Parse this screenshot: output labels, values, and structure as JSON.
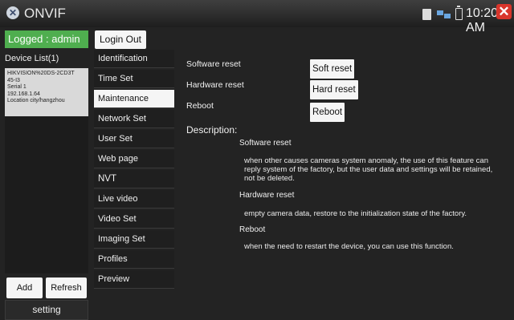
{
  "titlebar": {
    "app_title": "ONVIF",
    "app_icon": "x-circle-icon",
    "time": "10:20 AM",
    "status_icons": [
      "sd-card-icon",
      "network-icon",
      "battery-icon"
    ],
    "close_icon": "close-icon",
    "close_glyph": "✕"
  },
  "left": {
    "logged_label": "Logged : admin",
    "device_list_label": "Device List(1)",
    "device": {
      "line1": "HIKVISION%20DS-2CD3T",
      "line2": "45-I3",
      "line3": "Serial 1",
      "line4": "192.168.1.64",
      "line5": "Location city/hangzhou"
    },
    "add_label": "Add",
    "refresh_label": "Refresh",
    "setting_label": "setting"
  },
  "header": {
    "logout_label": "Login Out"
  },
  "menu": {
    "items": [
      {
        "label": "Identification"
      },
      {
        "label": "Time Set"
      },
      {
        "label": "Maintenance"
      },
      {
        "label": "Network Set"
      },
      {
        "label": "User Set"
      },
      {
        "label": "Web page"
      },
      {
        "label": "NVT"
      },
      {
        "label": "Live video"
      },
      {
        "label": "Video Set"
      },
      {
        "label": "Imaging Set"
      },
      {
        "label": "Profiles"
      },
      {
        "label": "Preview"
      }
    ],
    "active": "Maintenance"
  },
  "maintenance": {
    "software_reset_label": "Software reset",
    "hardware_reset_label": "Hardware reset",
    "reboot_label": "Reboot",
    "soft_reset_button": "Soft reset",
    "hard_reset_button": "Hard reset",
    "reboot_button": "Reboot",
    "description_title": "Description:",
    "desc": {
      "software_title": "Software reset",
      "software_text": "when other causes cameras system anomaly, the use of this feature can reply system of the factory, but the user data and settings will be retained, not be deleted.",
      "hardware_title": "Hardware reset",
      "hardware_text": "empty camera data, restore to the initialization state of the factory.",
      "reboot_title": "Reboot",
      "reboot_text": "when the need to restart the device, you can use this function."
    }
  },
  "colors": {
    "logged_bg": "#4fae4f",
    "close_bg": "#d9352b",
    "active_menu_bg": "#f5f5f5"
  }
}
